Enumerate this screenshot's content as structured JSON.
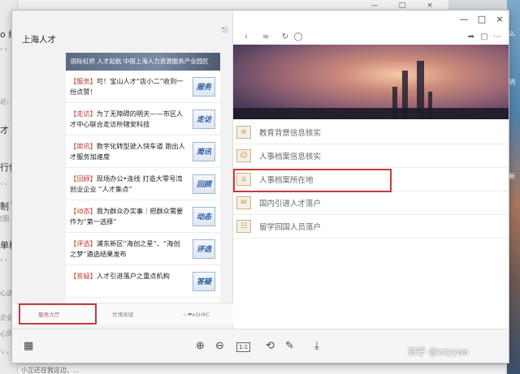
{
  "background": {
    "left_fragments": [
      "?",
      "o 绿:",
      "‹ ‹",
      "近: 小",
      "才",
      "行信",
      "‹ ‹",
      "制丫",
      "[图",
      "单移",
      "‹ ‹",
      "心选",
      "企业",
      "网/开",
      "心凭",
      "'‹ ‹"
    ],
    "bottom_fragments": "小芷还在我这边，..."
  },
  "window": {
    "controls": {
      "min": "—",
      "max": "□",
      "close": "×"
    }
  },
  "left_pane": {
    "title": "上海人才",
    "feed_header": "国际虹桥 人才起航 中国上海人力资源服务产业园区",
    "items": [
      {
        "tag": "【服务】",
        "text": "可！宝山人才“店小二”收到一份点赞！",
        "badge": "服务"
      },
      {
        "tag": "【走访】",
        "text": "为了无障碍的明天——市区人才中心联合走访所辖安科技",
        "badge": "走访"
      },
      {
        "tag": "【简讯】",
        "text": "数字化转型驶入快车道 跑出人才服务加速度",
        "badge": "简讯"
      },
      {
        "tag": "【回顾】",
        "text": "现场办公•连线 打造大零号湾创业企业 “人才集点”",
        "badge": "回顾"
      },
      {
        "tag": "【动态】",
        "text": "我为群众办实事｜把群众需要作为“第一选择”",
        "badge": "动态"
      },
      {
        "tag": "【评选】",
        "text": "浦东新区“海创之星”、“海创之梦”遴选结果发布",
        "badge": "评选"
      },
      {
        "tag": "【答疑】",
        "text": "人才引进落户之重点机构",
        "badge": "答疑"
      }
    ],
    "bottom_tabs": [
      "服务大厅",
      "世博商城",
      "☆❤eSHRC"
    ]
  },
  "right_pane": {
    "menu": [
      {
        "icon": "≡",
        "label": "教育背景信息核实"
      },
      {
        "icon": "☺",
        "label": "人事档案信息核实"
      },
      {
        "icon": "⌂",
        "label": "人事档案所在地"
      },
      {
        "icon": "✉",
        "label": "国内引进人才落户"
      },
      {
        "icon": "☷",
        "label": "留学回国人员落户"
      }
    ]
  },
  "bottom_toolbar": {
    "ratio_label": "1:1"
  },
  "watermark": {
    "text": "知乎 @zzyyaa"
  }
}
